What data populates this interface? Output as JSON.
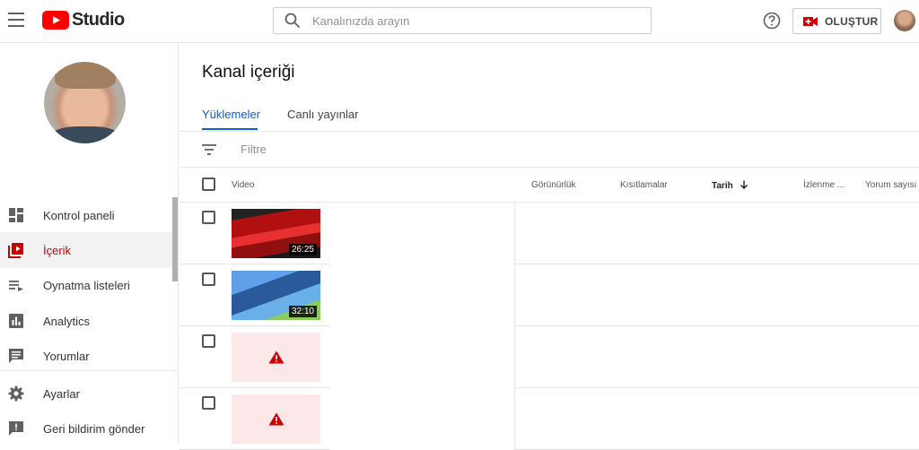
{
  "topbar": {
    "logo_text": "Studio",
    "search_placeholder": "Kanalınızda arayın",
    "create_label": "OLUŞTUR"
  },
  "sidebar": {
    "items": [
      {
        "label": "Kontrol paneli",
        "icon": "dashboard-icon"
      },
      {
        "label": "İçerik",
        "icon": "content-icon",
        "active": true
      },
      {
        "label": "Oynatma listeleri",
        "icon": "playlist-icon"
      },
      {
        "label": "Analytics",
        "icon": "analytics-icon"
      },
      {
        "label": "Yorumlar",
        "icon": "comments-icon"
      },
      {
        "label": "Ayarlar",
        "icon": "gear-icon"
      },
      {
        "label": "Geri bildirim gönder",
        "icon": "feedback-icon"
      }
    ]
  },
  "main": {
    "title": "Kanal içeriği",
    "tabs": [
      {
        "label": "Yüklemeler",
        "active": true
      },
      {
        "label": "Canlı yayınlar"
      }
    ],
    "filter_placeholder": "Filtre",
    "columns": {
      "video": "Video",
      "visibility": "Görünürlük",
      "restrictions": "Kısıtlamalar",
      "date": "Tarih",
      "views": "İzlenme ...",
      "comments": "Yorum sayısı"
    },
    "rows": [
      {
        "duration": "26:25"
      },
      {
        "duration": "32:10"
      },
      {
        "duration": ""
      },
      {
        "duration": ""
      }
    ]
  },
  "colors": {
    "accent": "#065fd4",
    "brand_red": "#ff0000",
    "active_nav": "#cc0000"
  }
}
